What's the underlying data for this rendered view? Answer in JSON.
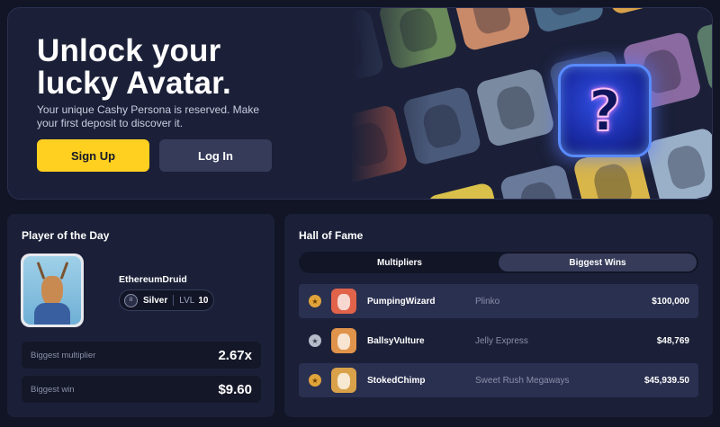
{
  "hero": {
    "title_line1": "Unlock your",
    "title_line2": "lucky Avatar.",
    "subtitle": "Your unique Cashy Persona is reserved. Make your first deposit to discover it.",
    "signup_label": "Sign Up",
    "login_label": "Log In",
    "mystery_glyph": "?"
  },
  "player_of_day": {
    "title": "Player of the Day",
    "name": "EthereumDruid",
    "rank": "Silver",
    "level_label": "LVL",
    "level": "10",
    "rank_icon_text": "II",
    "stats": [
      {
        "label": "Biggest multiplier",
        "value": "2.67x"
      },
      {
        "label": "Biggest win",
        "value": "$9.60"
      }
    ]
  },
  "hall_of_fame": {
    "title": "Hall of Fame",
    "tabs": [
      {
        "label": "Multipliers",
        "active": false
      },
      {
        "label": "Biggest Wins",
        "active": true
      }
    ],
    "rows": [
      {
        "medal": "gold",
        "user": "PumpingWizard",
        "game": "Plinko",
        "amount": "$100,000",
        "color": "#e0634a"
      },
      {
        "medal": "silver",
        "user": "BallsyVulture",
        "game": "Jelly Express",
        "amount": "$48,769",
        "color": "#e0934a"
      },
      {
        "medal": "gold",
        "user": "StokedChimp",
        "game": "Sweet Rush Megaways",
        "amount": "$45,939.50",
        "color": "#d9a24a"
      }
    ]
  },
  "colors": {
    "accent_yellow": "#ffd01f",
    "panel": "#1b2038",
    "background": "#121526"
  }
}
